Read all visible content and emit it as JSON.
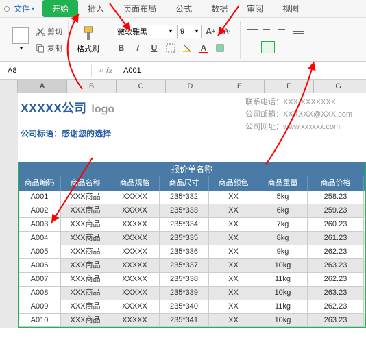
{
  "tabs": {
    "file": "文件",
    "items": [
      "开始",
      "插入",
      "页面布局",
      "公式",
      "数据",
      "审阅",
      "视图"
    ],
    "active": 0
  },
  "toolbar": {
    "cut": "剪切",
    "copy": "复制",
    "format_painter": "格式刷",
    "font_name": "微软雅黑",
    "font_size": "9",
    "bold": "B",
    "italic": "I",
    "underline": "U",
    "increase_font": "A",
    "decrease_font": "A"
  },
  "formula_bar": {
    "name_box": "A8",
    "fx": "fx",
    "value": "A001"
  },
  "columns": [
    "A",
    "B",
    "C",
    "D",
    "E",
    "F",
    "G"
  ],
  "company": {
    "title": "XXXXX公司",
    "logo": "logo",
    "slogan": "公司标语：感谢您的选择",
    "contact_phone_label": "联系电话：",
    "contact_phone": "XXX-XXXXXXX",
    "contact_email_label": "公司邮箱：",
    "contact_email": "XXXXXX@XXX.com",
    "contact_web_label": "公司网址：",
    "contact_web": "www.xxxxxx.com"
  },
  "quote": {
    "title": "报价单名称",
    "headers": [
      "商品编码",
      "商品名称",
      "商品规格",
      "商品尺寸",
      "商品颜色",
      "商品重量",
      "商品价格"
    ],
    "rows": [
      [
        "A001",
        "XXX商品",
        "XXXXX",
        "235*332",
        "XX",
        "5kg",
        "258.23"
      ],
      [
        "A002",
        "XXX商品",
        "XXXXX",
        "235*333",
        "XX",
        "6kg",
        "259.23"
      ],
      [
        "A003",
        "XXX商品",
        "XXXXX",
        "235*334",
        "XX",
        "7kg",
        "260.23"
      ],
      [
        "A004",
        "XXX商品",
        "XXXXX",
        "235*335",
        "XX",
        "8kg",
        "261.23"
      ],
      [
        "A005",
        "XXX商品",
        "XXXXX",
        "235*336",
        "XX",
        "9kg",
        "262.23"
      ],
      [
        "A006",
        "XXX商品",
        "XXXXX",
        "235*337",
        "XX",
        "10kg",
        "263.23"
      ],
      [
        "A007",
        "XXX商品",
        "XXXXX",
        "235*338",
        "XX",
        "11kg",
        "262.23"
      ],
      [
        "A008",
        "XXX商品",
        "XXXXX",
        "235*339",
        "XX",
        "10kg",
        "263.23"
      ],
      [
        "A009",
        "XXX商品",
        "XXXXX",
        "235*340",
        "XX",
        "11kg",
        "262.23"
      ],
      [
        "A010",
        "XXX商品",
        "XXXXX",
        "235*341",
        "XX",
        "10kg",
        "263.23"
      ]
    ]
  }
}
